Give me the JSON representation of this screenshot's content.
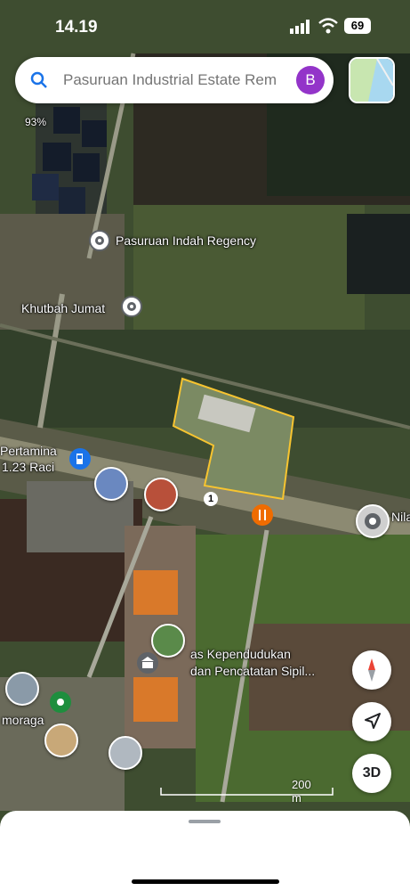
{
  "status_bar": {
    "time": "14.19",
    "battery": "69"
  },
  "search": {
    "placeholder": "Pasuruan Industrial Estate Rem",
    "avatar_letter": "B"
  },
  "map_labels": {
    "percent": "93%",
    "regency": "Pasuruan Indah Regency",
    "khutbah": "Khutbah Jumat",
    "pertamina_line1": "Pertamina",
    "pertamina_line2": "1.23 Raci",
    "nila": "Nila",
    "dinas_line1": "as Kependudukan",
    "dinas_line2": "dan Pencatatan Sipil...",
    "moraga": "moraga",
    "road_shield": "1"
  },
  "controls": {
    "three_d": "3D",
    "scale_label": "200 m"
  },
  "colors": {
    "accent": "#1a73e8",
    "avatar": "#9334c9",
    "highlight": "#f7c430"
  }
}
